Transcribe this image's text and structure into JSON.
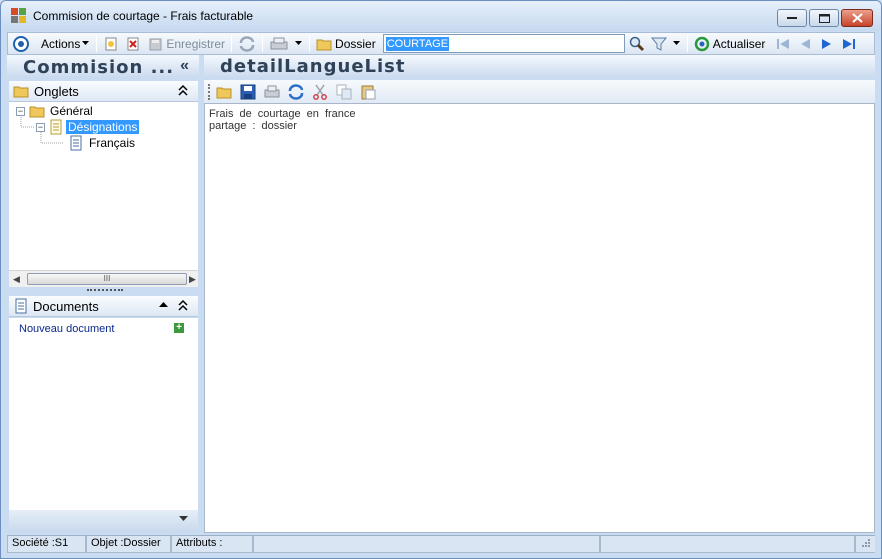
{
  "window": {
    "title": "Commision  de  courtage -  Frais facturable"
  },
  "toolbar": {
    "actions_label": "Actions",
    "save_label": "Enregistrer",
    "folder_label": "Dossier",
    "search_value": "COURTAGE",
    "refresh_label": "Actualiser"
  },
  "left_panel": {
    "title": "Commision  ...",
    "collapse_glyph": "«",
    "tabs_group": {
      "title": "Onglets"
    },
    "tree": {
      "root": "Général",
      "child": "Désignations",
      "grandchild": "Français"
    },
    "scroll_thumb": "III",
    "documents_group": {
      "title": "Documents",
      "new_document": "Nouveau document"
    }
  },
  "right_panel": {
    "title": "detailLangueList",
    "content_lines": [
      "Frais  de  courtage  en  france",
      "partage  :  dossier"
    ]
  },
  "statusbar": {
    "societe": "Société :S1",
    "objet": "Objet :Dossier",
    "attributs": "Attributs :"
  },
  "colors": {
    "accent": "#3399ff",
    "titlebar": "#c6d9ef",
    "header_text": "#2f4258",
    "close_button": "#c7432b",
    "link": "#0a2a8c"
  }
}
